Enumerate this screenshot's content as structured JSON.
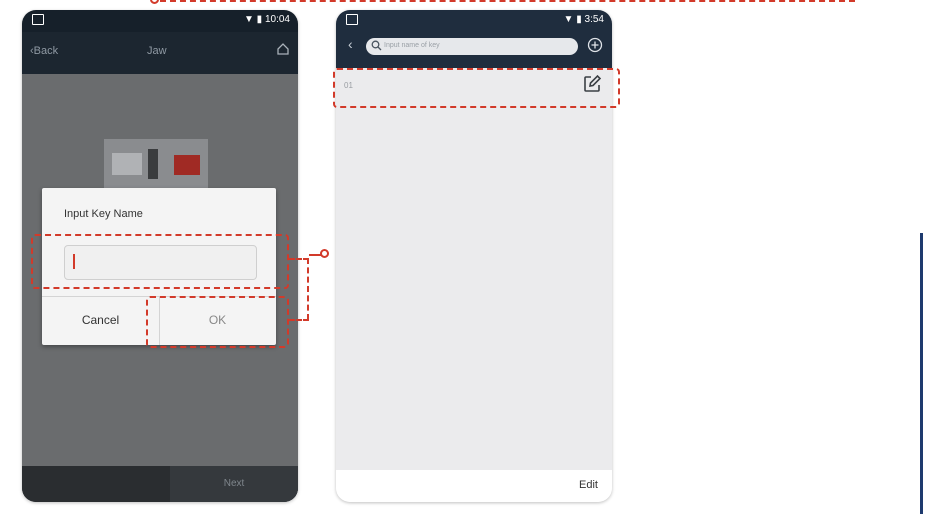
{
  "phone1": {
    "status_time": "10:04",
    "nav_back": "Back",
    "nav_title": "Jaw",
    "dialog_title": "Input Key Name",
    "cancel_label": "Cancel",
    "ok_label": "OK",
    "bottom_next": "Next"
  },
  "phone2": {
    "status_time": "3:54",
    "search_placeholder": "Input name of key",
    "key_item": "01",
    "edit_label": "Edit"
  },
  "colors": {
    "annotation": "#d23a2a",
    "phone2_header": "#1f2d3e"
  }
}
